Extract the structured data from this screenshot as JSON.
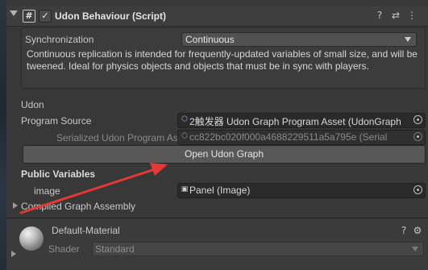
{
  "component": {
    "title": "Udon Behaviour (Script)",
    "enabled_check": "✓",
    "script_icon": "#"
  },
  "sync": {
    "label": "Synchronization",
    "value": "Continuous",
    "description": "Continuous replication is intended for frequently-updated variables of small size, and will be tweened. Ideal for physics objects and objects that must be in sync with players."
  },
  "udon": {
    "section": "Udon",
    "program_source_label": "Program Source",
    "program_source_value": "2触发器 Udon Graph Program Asset (UdonGraph",
    "serialized_label": "Serialized Udon Program Asset",
    "serialized_value": "cc822bc020f000a4688229511a5a795e (Serial",
    "open_button": "Open Udon Graph"
  },
  "public_variables": {
    "heading": "Public Variables",
    "items": [
      {
        "label": "image",
        "value": "Panel (Image)"
      }
    ]
  },
  "compiled": {
    "label": "Compiled Graph Assembly"
  },
  "material": {
    "name": "Default-Material",
    "shader_label": "Shader",
    "shader_value": "Standard"
  },
  "icons": {
    "help": "help-icon",
    "preset": "preset-icon",
    "menu": "kebab-menu-icon",
    "gear": "gear-icon"
  },
  "colors": {
    "annotation_arrow": "#e53935"
  }
}
